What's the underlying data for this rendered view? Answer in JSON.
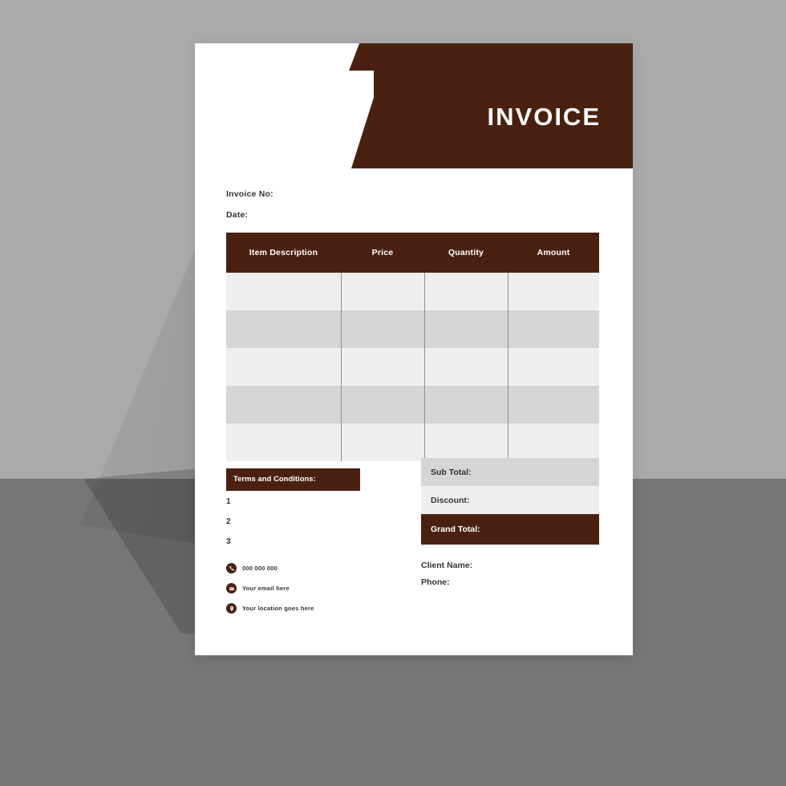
{
  "document": {
    "header_title": "INVOICE",
    "meta": {
      "invoice_no_label": "Invoice No:",
      "date_label": "Date:"
    },
    "table": {
      "columns": [
        "Item Description",
        "Price",
        "Quantity",
        "Amount"
      ],
      "rows": [
        [
          "",
          "",
          "",
          ""
        ],
        [
          "",
          "",
          "",
          ""
        ],
        [
          "",
          "",
          "",
          ""
        ],
        [
          "",
          "",
          "",
          ""
        ],
        [
          "",
          "",
          "",
          ""
        ]
      ]
    },
    "terms": {
      "heading": "Terms and Conditions:",
      "items": [
        "1",
        "2",
        "3"
      ]
    },
    "totals": [
      {
        "label": "Sub Total:",
        "value": ""
      },
      {
        "label": "Discount:",
        "value": ""
      },
      {
        "label": "Grand Total:",
        "value": ""
      }
    ],
    "client": {
      "name_label": "Client Name:",
      "phone_label": "Phone:"
    },
    "contacts": [
      {
        "icon": "phone-icon",
        "text": "000 000 000"
      },
      {
        "icon": "email-icon",
        "text": "Your email here"
      },
      {
        "icon": "location-icon",
        "text": "Your location goes here"
      }
    ],
    "colors": {
      "brand": "#4a2110",
      "row_light": "#efefef",
      "row_dark": "#d3d5d7",
      "background_top": "#aaaaaa",
      "background_bottom": "#767676"
    }
  }
}
